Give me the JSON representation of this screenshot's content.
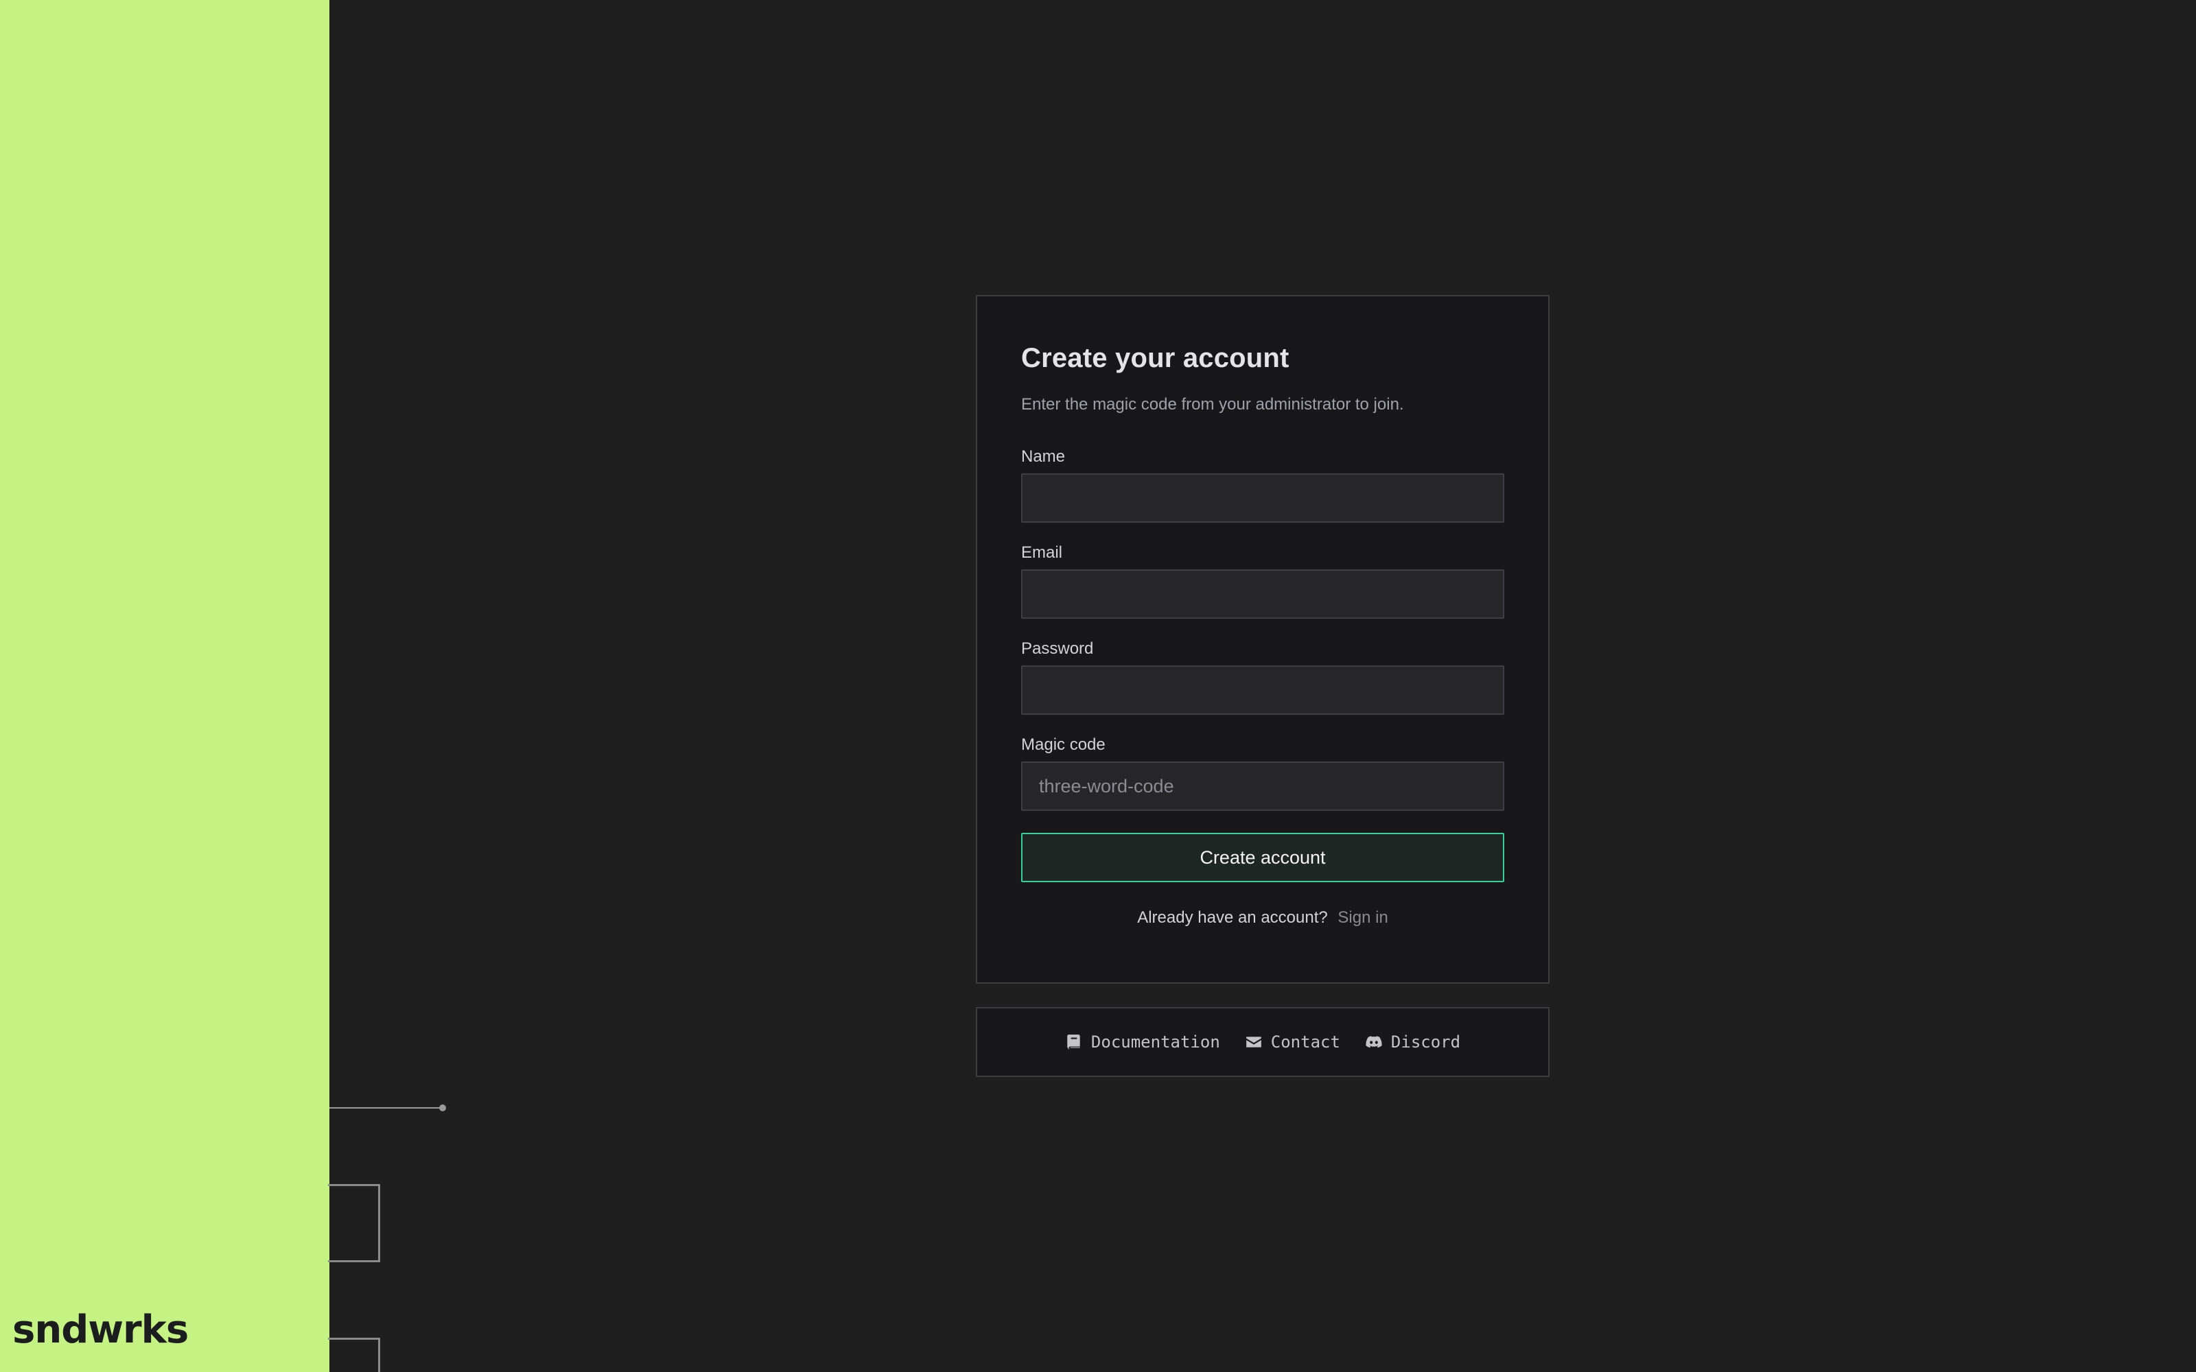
{
  "theme": {
    "brand": "#c4f383",
    "accent": "#34d399"
  },
  "brand": {
    "logo": "sndwrks"
  },
  "signup": {
    "title": "Create your account",
    "subtitle": "Enter the magic code from your administrator to join.",
    "fields": {
      "name": {
        "label": "Name",
        "value": "",
        "placeholder": ""
      },
      "email": {
        "label": "Email",
        "value": "",
        "placeholder": ""
      },
      "password": {
        "label": "Password",
        "value": "",
        "placeholder": ""
      },
      "magic_code": {
        "label": "Magic code",
        "value": "",
        "placeholder": "three-word-code"
      }
    },
    "submit_label": "Create account",
    "signin_prompt": "Already have an account?",
    "signin_link": "Sign in"
  },
  "footer": {
    "links": [
      {
        "label": "Documentation",
        "icon": "book-icon"
      },
      {
        "label": "Contact",
        "icon": "envelope-icon"
      },
      {
        "label": "Discord",
        "icon": "discord-icon"
      }
    ]
  }
}
